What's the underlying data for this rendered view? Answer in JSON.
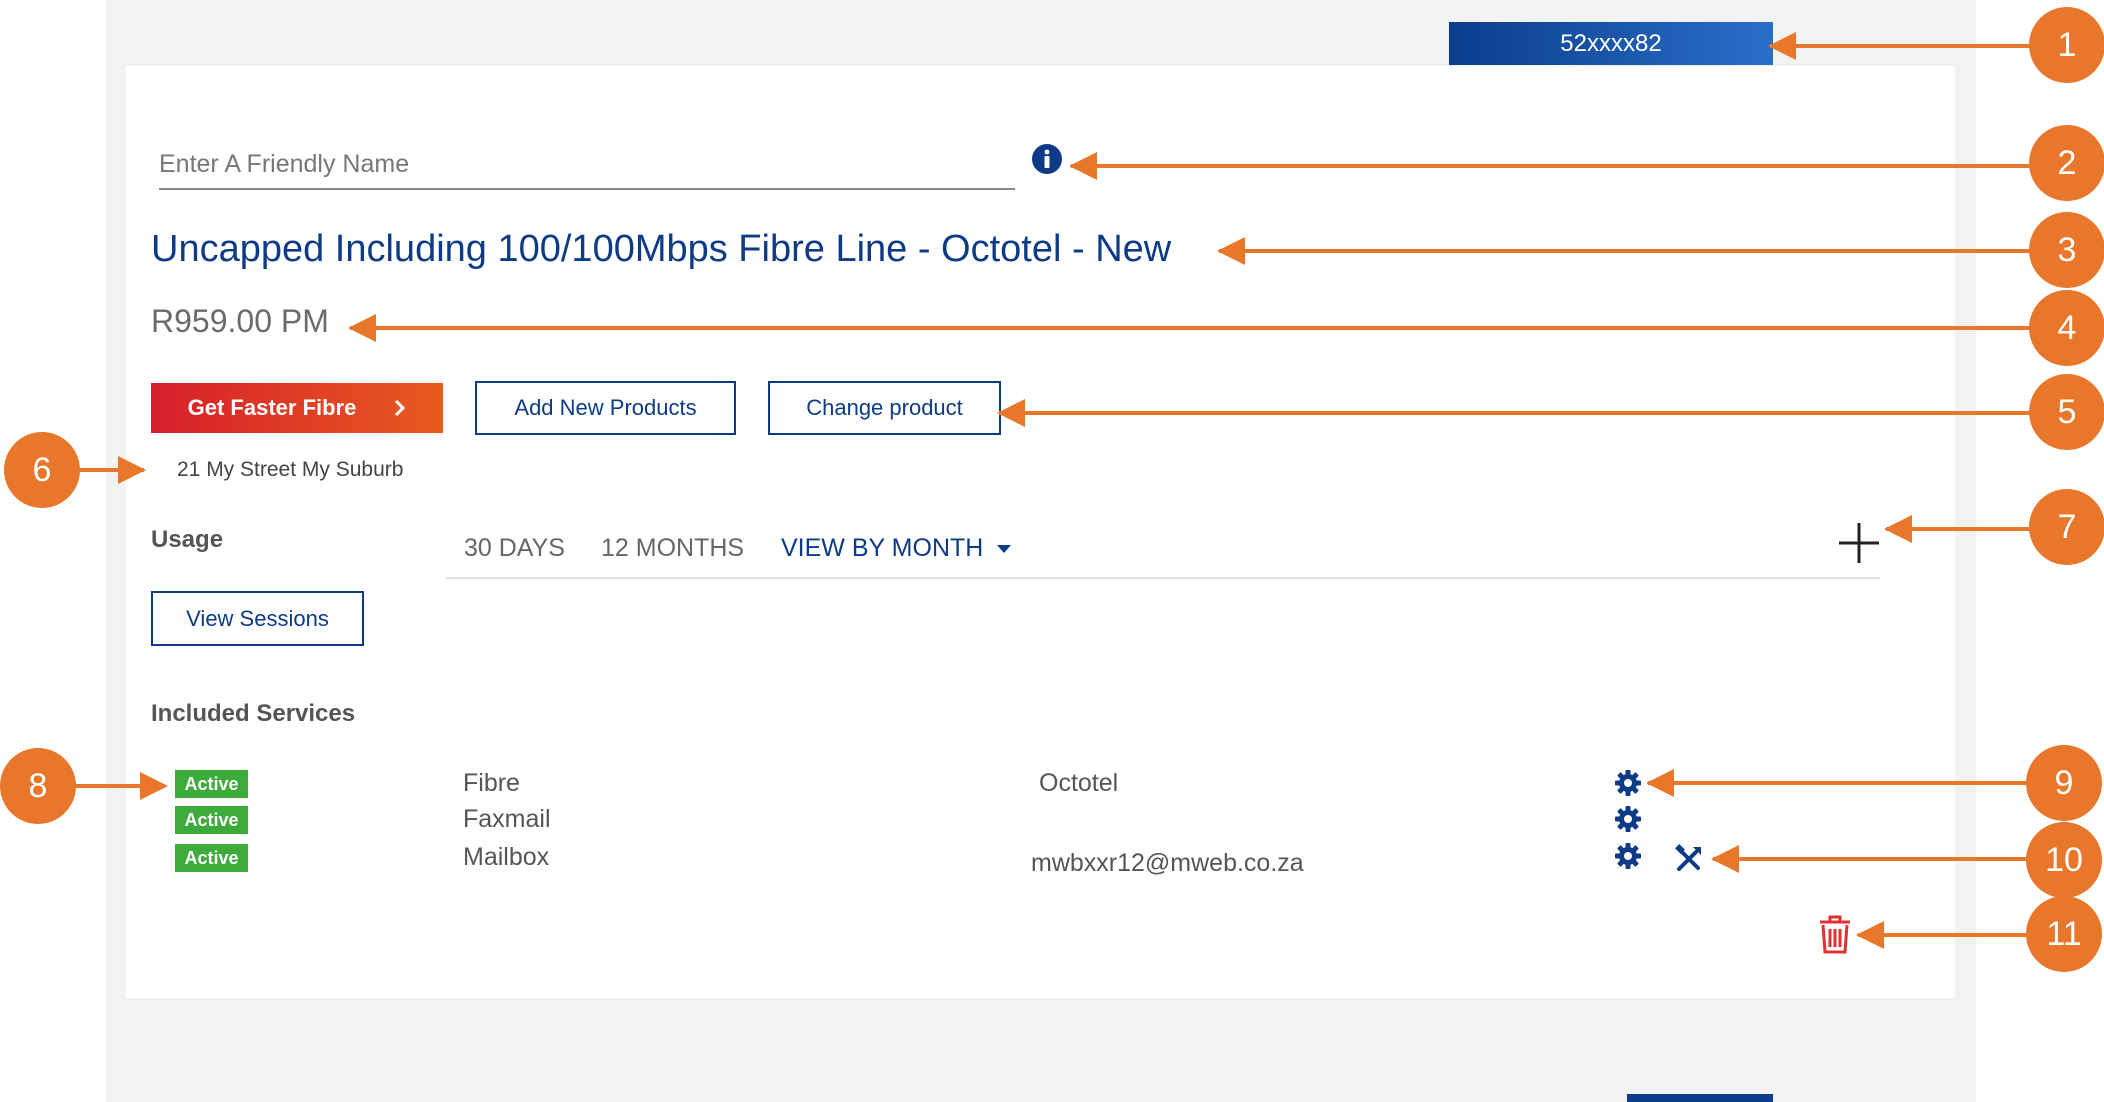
{
  "account": {
    "number": "52xxxx82"
  },
  "friendly_name": {
    "placeholder": "Enter A Friendly Name",
    "value": ""
  },
  "product": {
    "title": "Uncapped Including 100/100Mbps Fibre Line - Octotel - New",
    "price": "R959.00 PM"
  },
  "actions": {
    "faster_fibre": "Get Faster Fibre",
    "add_products": "Add New Products",
    "change_product": "Change product"
  },
  "address": "21 My Street My Suburb",
  "usage": {
    "label": "Usage",
    "tabs": [
      "30 DAYS",
      "12 MONTHS",
      "VIEW BY MONTH"
    ],
    "view_sessions": "View Sessions"
  },
  "included": {
    "label": "Included Services",
    "services": [
      {
        "status": "Active",
        "name": "Fibre",
        "provider": "Octotel"
      },
      {
        "status": "Active",
        "name": "Faxmail",
        "provider": ""
      },
      {
        "status": "Active",
        "name": "Mailbox",
        "provider": "mwbxxr12@mweb.co.za"
      }
    ]
  },
  "callouts": [
    "1",
    "2",
    "3",
    "4",
    "5",
    "6",
    "7",
    "8",
    "9",
    "10",
    "11"
  ],
  "colors": {
    "brand_blue": "#0d3b85",
    "callout_orange": "#e8762b",
    "active_green": "#3cab3c",
    "delete_red": "#e03131"
  }
}
